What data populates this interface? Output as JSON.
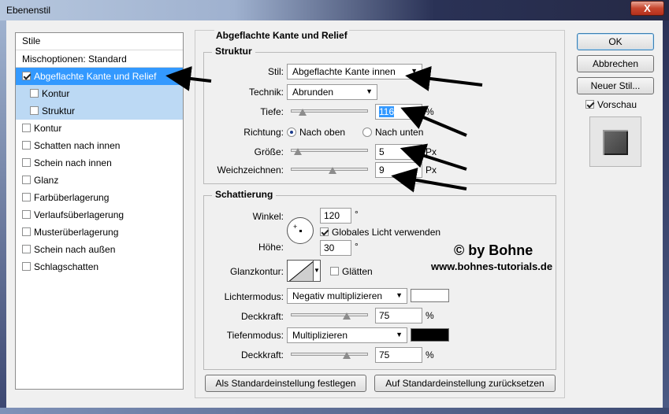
{
  "window": {
    "title": "Ebenenstil",
    "close_label": "X"
  },
  "styles_panel": {
    "header": "Stile",
    "blend_options": "Mischoptionen: Standard",
    "items": [
      {
        "label": "Abgeflachte Kante und Relief",
        "checked": true,
        "selected": true
      },
      {
        "label": "Kontur",
        "checked": false,
        "sub": true
      },
      {
        "label": "Struktur",
        "checked": false,
        "sub": true
      },
      {
        "label": "Kontur",
        "checked": false
      },
      {
        "label": "Schatten nach innen",
        "checked": false
      },
      {
        "label": "Schein nach innen",
        "checked": false
      },
      {
        "label": "Glanz",
        "checked": false
      },
      {
        "label": "Farbüberlagerung",
        "checked": false
      },
      {
        "label": "Verlaufsüberlagerung",
        "checked": false
      },
      {
        "label": "Musterüberlagerung",
        "checked": false
      },
      {
        "label": "Schein nach außen",
        "checked": false
      },
      {
        "label": "Schlagschatten",
        "checked": false
      }
    ]
  },
  "bevel": {
    "title": "Abgeflachte Kante und Relief",
    "structure": {
      "title": "Struktur",
      "style_label": "Stil:",
      "style_value": "Abgeflachte Kante innen",
      "technique_label": "Technik:",
      "technique_value": "Abrunden",
      "depth_label": "Tiefe:",
      "depth_value": "116",
      "depth_unit": "%",
      "depth_slider": 0.1,
      "direction_label": "Richtung:",
      "direction_up": "Nach oben",
      "direction_down": "Nach unten",
      "size_label": "Größe:",
      "size_value": "5",
      "size_unit": "Px",
      "size_slider": 0.03,
      "soften_label": "Weichzeichnen:",
      "soften_value": "9",
      "soften_unit": "Px",
      "soften_slider": 0.55
    },
    "shading": {
      "title": "Schattierung",
      "angle_label": "Winkel:",
      "angle_value": "120",
      "angle_unit": "°",
      "global_light_label": "Globales Licht verwenden",
      "altitude_label": "Höhe:",
      "altitude_value": "30",
      "altitude_unit": "°",
      "gloss_label": "Glanzkontur:",
      "antialias_label": "Glätten",
      "highlight_mode_label": "Lichtermodus:",
      "highlight_mode_value": "Negativ multiplizieren",
      "highlight_color": "#ffffff",
      "highlight_opacity_label": "Deckkraft:",
      "highlight_opacity_value": "75",
      "highlight_opacity_unit": "%",
      "highlight_opacity_slider": 0.75,
      "shadow_mode_label": "Tiefenmodus:",
      "shadow_mode_value": "Multiplizieren",
      "shadow_color": "#000000",
      "shadow_opacity_label": "Deckkraft:",
      "shadow_opacity_value": "75",
      "shadow_opacity_unit": "%",
      "shadow_opacity_slider": 0.75
    },
    "make_default": "Als Standardeinstellung festlegen",
    "reset_default": "Auf Standardeinstellung zurücksetzen"
  },
  "buttons": {
    "ok": "OK",
    "cancel": "Abbrechen",
    "new_style": "Neuer Stil...",
    "preview": "Vorschau"
  },
  "watermark": {
    "line1": "© by Bohne",
    "line2": "www.bohnes-tutorials.de"
  }
}
